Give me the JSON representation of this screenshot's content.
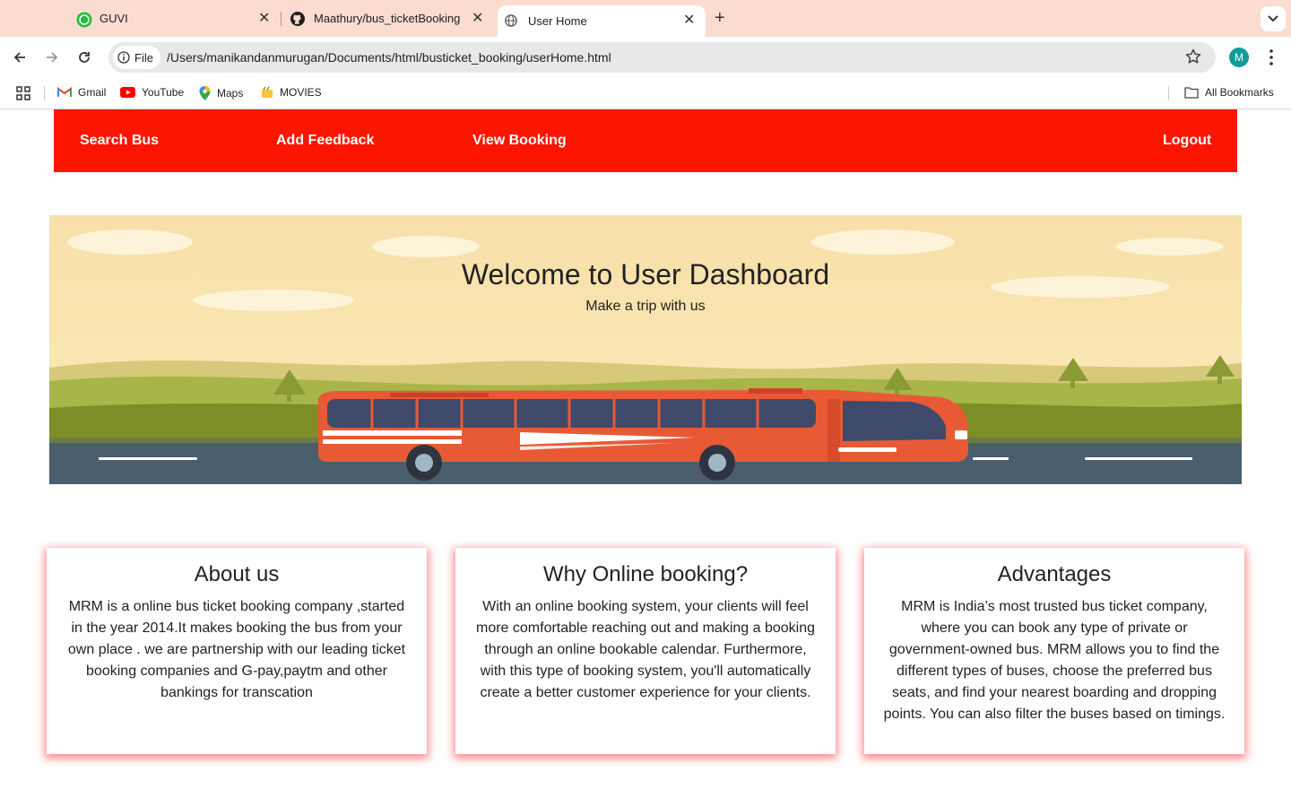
{
  "browser": {
    "tabs": [
      {
        "title": "GUVI",
        "favicon": "guvi-icon"
      },
      {
        "title": "Maathury/bus_ticketBooking",
        "favicon": "github-icon"
      },
      {
        "title": "User Home",
        "favicon": "globe-icon",
        "active": true
      }
    ],
    "address": {
      "chip_label": "File",
      "url": "/Users/manikandanmurugan/Documents/html/busticket_booking/userHome.html"
    },
    "profile_initial": "M",
    "bookmarks": [
      {
        "label": "Gmail",
        "icon": "gmail-icon"
      },
      {
        "label": "YouTube",
        "icon": "youtube-icon"
      },
      {
        "label": "Maps",
        "icon": "maps-icon"
      },
      {
        "label": "MOVIES",
        "icon": "movies-icon"
      }
    ],
    "all_bookmarks_label": "All Bookmarks"
  },
  "nav": {
    "search_bus": "Search Bus",
    "add_feedback": "Add Feedback",
    "view_booking": "View Booking",
    "logout": "Logout"
  },
  "hero": {
    "title": "Welcome to User Dashboard",
    "subtitle": "Make a trip with us"
  },
  "cards": [
    {
      "title": "About us",
      "body": "MRM is a online bus ticket booking company ,started in the year 2014.It makes booking the bus from your own place . we are partnership with our leading ticket booking companies and G-pay,paytm and other bankings for transcation"
    },
    {
      "title": "Why Online booking?",
      "body": "With an online booking system, your clients will feel more comfortable reaching out and making a booking through an online bookable calendar. Furthermore, with this type of booking system, you'll automatically create a better customer experience for your clients."
    },
    {
      "title": "Advantages",
      "body": "MRM is India’s most trusted bus ticket company, where you can book any type of private or government-owned bus. MRM allows you to find the different types of buses, choose the preferred bus seats, and find your nearest boarding and dropping points. You can also filter the buses based on timings."
    }
  ],
  "colors": {
    "nav_red": "#fc1500",
    "tabstrip": "#fcdcd0",
    "card_shadow": "#ff2828"
  }
}
